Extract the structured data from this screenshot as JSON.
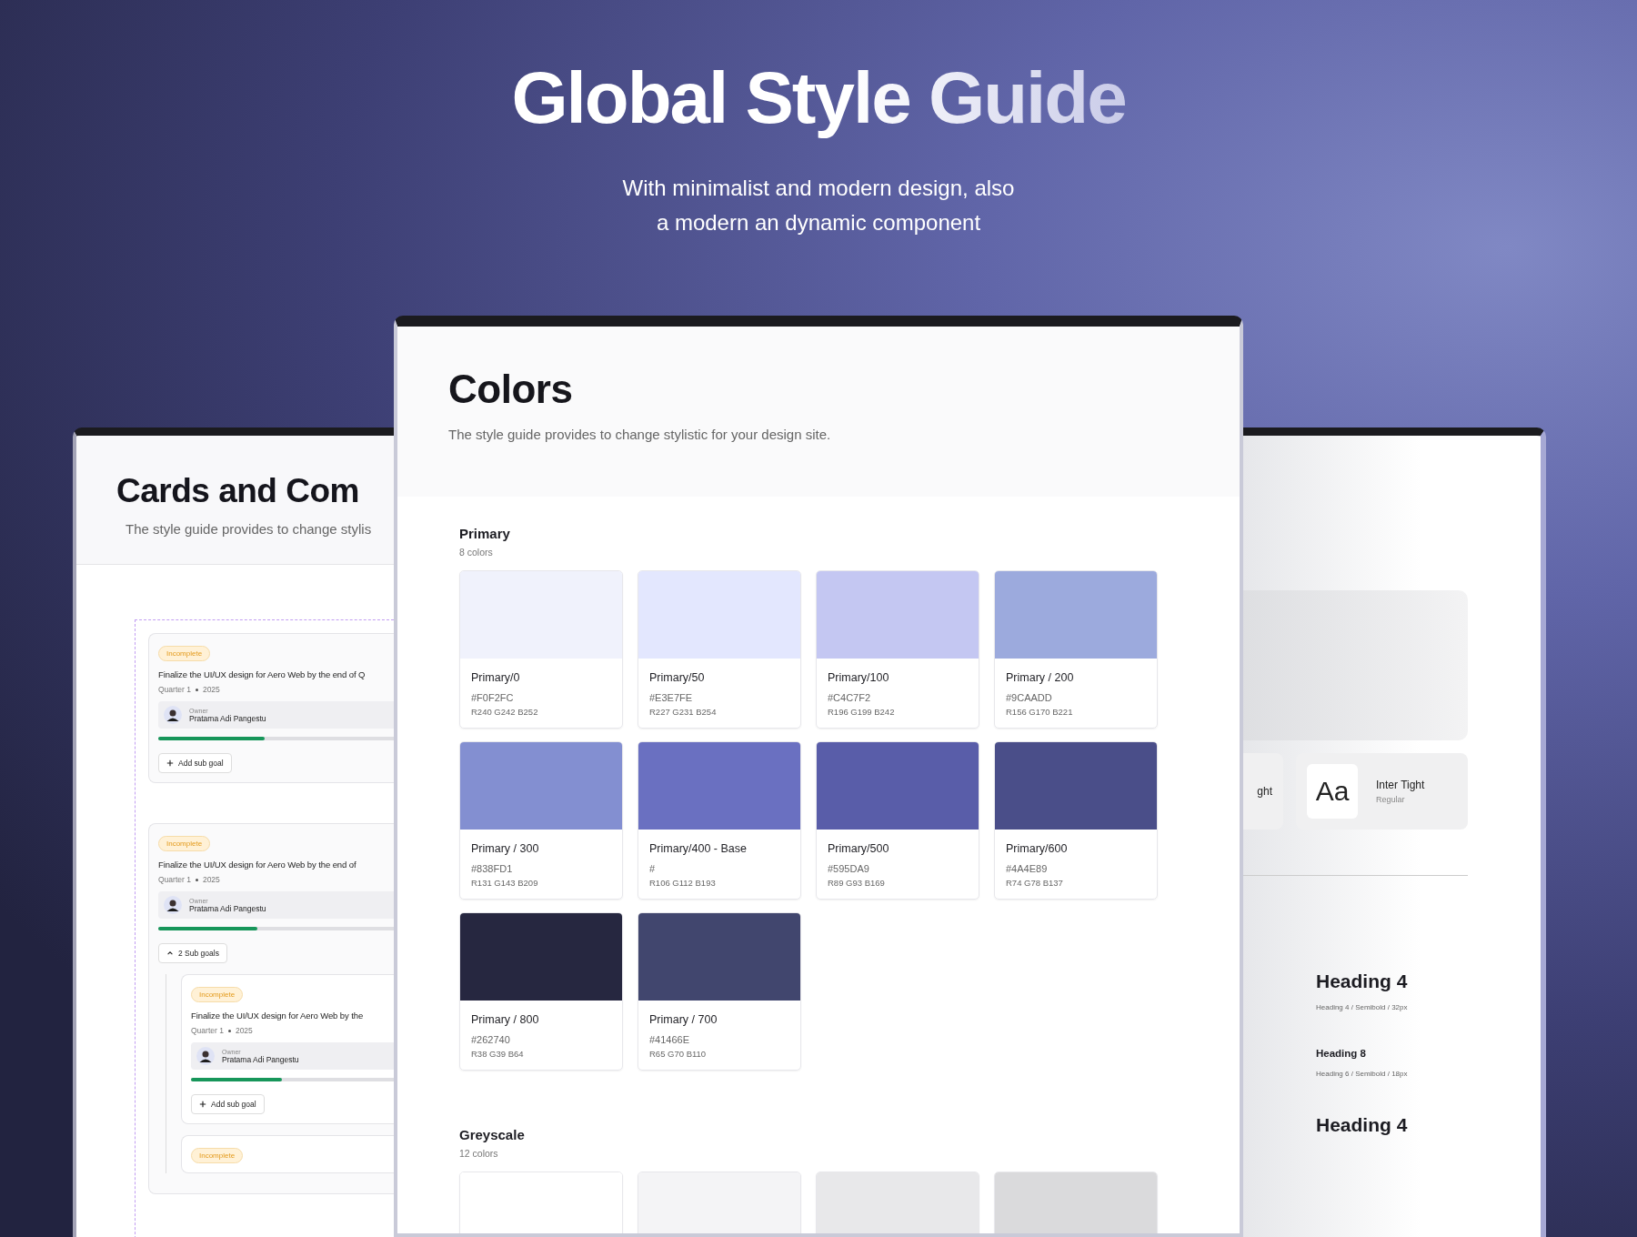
{
  "hero": {
    "title": "Global Style Guide",
    "subtitle_lines": [
      "With minimalist and modern design, also",
      "a modern an dynamic component"
    ]
  },
  "left_page": {
    "title": "Cards and Com",
    "description": "The style guide provides to change stylis",
    "goals": [
      {
        "badge": "Incomplete",
        "title": "Finalize the UI/UX design for Aero Web by the end of Q",
        "quarter": "Quarter 1",
        "year": "2025",
        "owner_label": "Owner",
        "owner": "Pratama Adi Pangestu",
        "level": 0.45,
        "action": {
          "kind": "add",
          "label": "Add sub goal"
        }
      },
      {
        "badge": "Incomplete",
        "title": "Finalize the UI/UX design for Aero Web by the end of",
        "quarter": "Quarter 1",
        "year": "2025",
        "owner_label": "Owner",
        "owner": "Pratama Adi Pangestu",
        "level": 0.42,
        "action": {
          "kind": "collapse",
          "label": "2 Sub goals"
        },
        "children": [
          {
            "badge": "Incomplete",
            "title": "Finalize the UI/UX design for Aero Web by the",
            "quarter": "Quarter 1",
            "year": "2025",
            "owner_label": "Owner",
            "owner": "Pratama Adi Pangestu",
            "level": 0.45,
            "action": {
              "kind": "add",
              "label": "Add sub goal"
            }
          },
          {
            "badge": "Incomplete"
          }
        ]
      }
    ]
  },
  "colors_page": {
    "title": "Colors",
    "description": "The style guide provides to change stylistic for your design site.",
    "groups": [
      {
        "name": "Primary",
        "count": "8 colors",
        "swatches": [
          {
            "name": "Primary/0",
            "hex": "#F0F2FC",
            "rgb": "R240 G242 B252",
            "color": "#f0f2fc"
          },
          {
            "name": "Primary/50",
            "hex": "#E3E7FE",
            "rgb": "R227 G231 B254",
            "color": "#e3e7fe"
          },
          {
            "name": "Primary/100",
            "hex": "#C4C7F2",
            "rgb": "R196 G199 B242",
            "color": "#c4c7f2"
          },
          {
            "name": "Primary / 200",
            "hex": "#9CAADD",
            "rgb": "R156 G170 B221",
            "color": "#9caadd"
          },
          {
            "name": "Primary / 300",
            "hex": "#838FD1",
            "rgb": "R131 G143 B209",
            "color": "#838fd1"
          },
          {
            "name": "Primary/400 - Base",
            "hex": "#",
            "rgb": "R106 G112 B193",
            "color": "#6a70c1"
          },
          {
            "name": "Primary/500",
            "hex": "#595DA9",
            "rgb": "R89 G93 B169",
            "color": "#595da9"
          },
          {
            "name": "Primary/600",
            "hex": "#4A4E89",
            "rgb": "R74 G78 B137",
            "color": "#4a4e89"
          },
          {
            "name": "Primary / 800",
            "hex": "#262740",
            "rgb": "R38 G39 B64",
            "color": "#262740"
          },
          {
            "name": "Primary / 700",
            "hex": "#41466E",
            "rgb": "R65 G70 B110",
            "color": "#41466e"
          }
        ]
      },
      {
        "name": "Greyscale",
        "count": "12 colors",
        "swatches": [
          {
            "color": "#ffffff"
          },
          {
            "color": "#f4f4f6"
          },
          {
            "color": "#e8e8ea"
          },
          {
            "color": "#dadadc"
          }
        ]
      }
    ]
  },
  "right_page": {
    "fonts": [
      {
        "name": "ght"
      },
      {
        "sample": "Aa",
        "name": "Inter Tight",
        "weight": "Regular"
      }
    ],
    "headings": [
      {
        "kind": "h4",
        "text": "Heading 4",
        "spec": "Heading 4 / Semibold / 32px"
      },
      {
        "kind": "h6",
        "text": "Heading 8",
        "spec": "Heading 6 / Semibold / 18px"
      },
      {
        "kind": "h4",
        "text": "Heading 4"
      }
    ]
  }
}
